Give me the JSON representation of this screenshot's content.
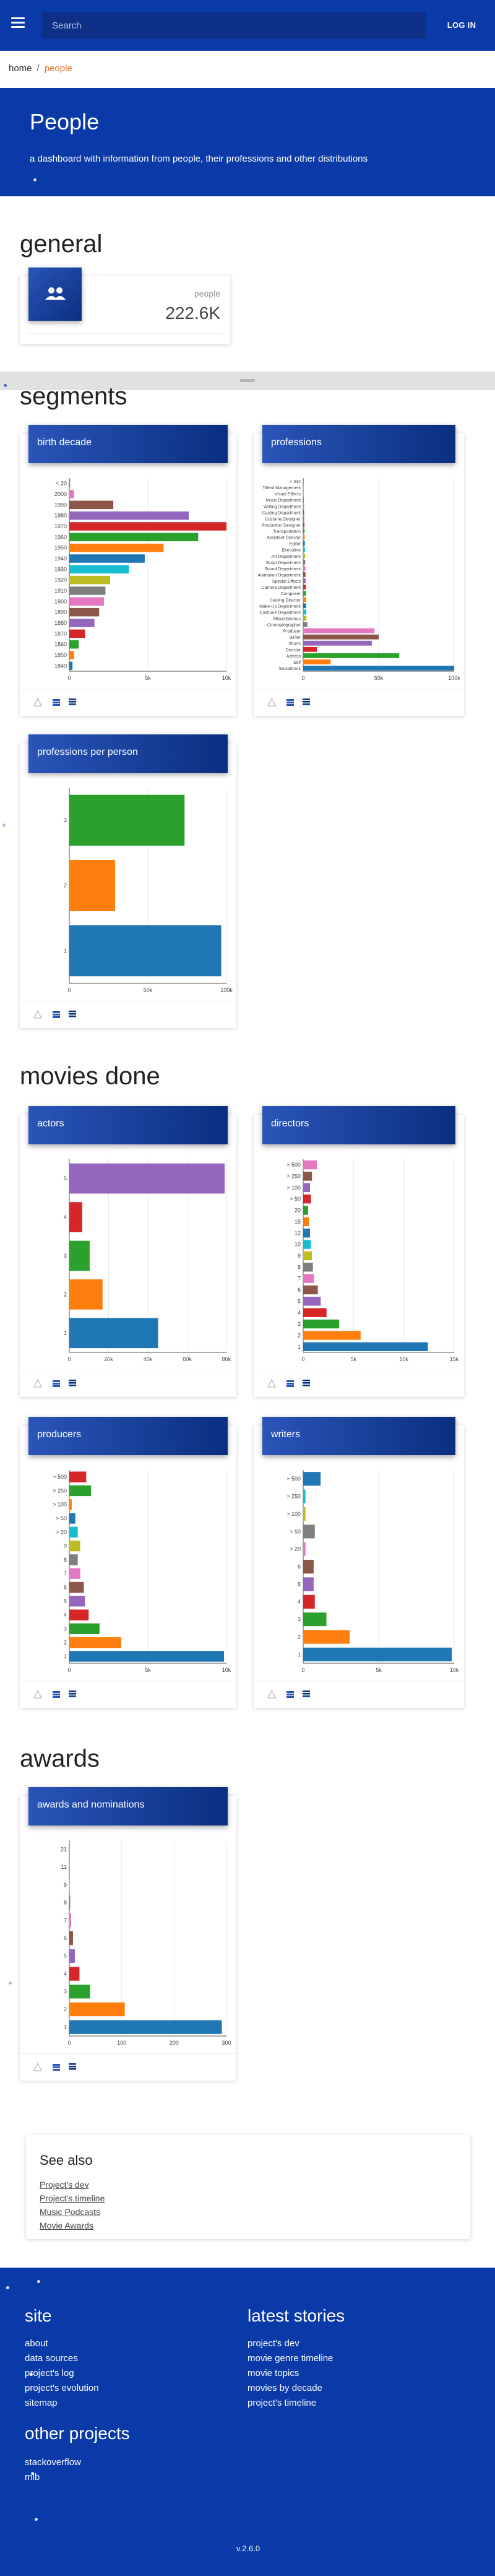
{
  "topbar": {
    "search_placeholder": "Search",
    "login_label": "LOG IN"
  },
  "breadcrumb": {
    "home": "home",
    "separator": "/",
    "current": "people"
  },
  "hero": {
    "title": "People",
    "subtitle": "a dashboard with information from people, their professions and other distributions"
  },
  "sections": {
    "general": "general",
    "segments": "segments",
    "movies_done": "movies done",
    "awards": "awards"
  },
  "kpi": {
    "label": "people",
    "value": "222.6K",
    "icon": "people-icon"
  },
  "cards": {
    "birth_decade": "birth decade",
    "professions": "professions",
    "professions_per_person": "professions per person",
    "actors": "actors",
    "directors": "directors",
    "producers": "producers",
    "writers": "writers",
    "awards_and_nominations": "awards and nominations"
  },
  "chart_data": [
    {
      "id": "birth_decade",
      "type": "bar",
      "orientation": "horizontal",
      "categories": [
        "< 20",
        "2000",
        "1990",
        "1980",
        "1970",
        "1960",
        "1950",
        "1940",
        "1930",
        "1920",
        "1910",
        "1900",
        "1890",
        "1880",
        "1870",
        "1860",
        "1850",
        "1840"
      ],
      "values": [
        50,
        300,
        2800,
        7600,
        10000,
        8200,
        6000,
        4800,
        3800,
        2600,
        2300,
        2200,
        1900,
        1600,
        1000,
        600,
        300,
        200
      ],
      "xticks": [
        "0",
        "5k",
        "10k"
      ],
      "xlim": [
        0,
        10000
      ]
    },
    {
      "id": "professions",
      "type": "bar",
      "orientation": "horizontal",
      "categories": [
        "< 332",
        "Talent Management",
        "Visual Effects",
        "Music Department",
        "Writing Department",
        "Casting Department",
        "Costume Designer",
        "Production Designer",
        "Transportation",
        "Assistant Director",
        "Editor",
        "Executive",
        "Art Department",
        "Script Department",
        "Sound Department",
        "Animation Department",
        "Special Effects",
        "Camera Department",
        "Composer",
        "Casting Director",
        "Make-Up Department",
        "Costume Department",
        "Miscellaneous",
        "Cinematographer",
        "Producer",
        "Writer",
        "Stunts",
        "Director",
        "Actress",
        "Self",
        "Soundtrack"
      ],
      "values": [
        300,
        300,
        400,
        500,
        600,
        700,
        800,
        900,
        1000,
        1100,
        1200,
        1300,
        1400,
        1500,
        1600,
        1700,
        1800,
        1900,
        2000,
        2100,
        2200,
        2300,
        2400,
        3000,
        52000,
        55000,
        50000,
        10000,
        70000,
        20000,
        110000
      ],
      "xticks": [
        "0",
        "50k",
        "100k"
      ],
      "xlim": [
        0,
        110000
      ]
    },
    {
      "id": "professions_per_person",
      "type": "bar",
      "orientation": "horizontal",
      "categories": [
        "3",
        "2",
        "1"
      ],
      "values": [
        88000,
        35000,
        116000
      ],
      "colors": [
        "#2ca02c",
        "#ff7f0e",
        "#1f77b4"
      ],
      "xticks": [
        "0",
        "50k",
        "100k"
      ],
      "xlim": [
        0,
        120000
      ]
    },
    {
      "id": "actors",
      "type": "bar",
      "orientation": "horizontal",
      "categories": [
        "5",
        "4",
        "3",
        "2",
        "1"
      ],
      "values": [
        84000,
        7000,
        11000,
        18000,
        48000
      ],
      "colors": [
        "#9467bd",
        "#d62728",
        "#2ca02c",
        "#ff7f0e",
        "#1f77b4"
      ],
      "xticks": [
        "0",
        "20k",
        "40k",
        "60k",
        "80k"
      ],
      "xlim": [
        0,
        85000
      ]
    },
    {
      "id": "directors",
      "type": "bar",
      "orientation": "horizontal",
      "categories": [
        "> 500",
        "> 250",
        "> 100",
        "> 50",
        "20",
        "15",
        "12",
        "10",
        "9",
        "8",
        "7",
        "6",
        "5",
        "4",
        "3",
        "2",
        "1"
      ],
      "values": [
        1400,
        900,
        700,
        800,
        500,
        600,
        700,
        800,
        900,
        1000,
        1100,
        1500,
        1800,
        2400,
        3700,
        5900,
        12800
      ],
      "xticks": [
        "0",
        "5k",
        "10k",
        "15k"
      ],
      "xlim": [
        0,
        15500
      ]
    },
    {
      "id": "producers",
      "type": "bar",
      "orientation": "horizontal",
      "categories": [
        "> 500",
        "> 250",
        "> 100",
        "> 50",
        "> 20",
        "9",
        "8",
        "7",
        "6",
        "5",
        "4",
        "3",
        "2",
        "1"
      ],
      "values": [
        1400,
        1800,
        200,
        500,
        700,
        900,
        700,
        900,
        1200,
        1300,
        1600,
        2500,
        4300,
        12800
      ],
      "xticks": [
        "0",
        "5k",
        "10k"
      ],
      "xlim": [
        0,
        13000
      ]
    },
    {
      "id": "writers",
      "type": "bar",
      "orientation": "horizontal",
      "categories": [
        "> 500",
        "> 250",
        "> 100",
        "> 50",
        "> 20",
        "6",
        "5",
        "4",
        "3",
        "2",
        "1"
      ],
      "values": [
        1500,
        200,
        200,
        1000,
        200,
        900,
        900,
        1000,
        2000,
        4000,
        12800
      ],
      "xticks": [
        "0",
        "5k",
        "10k"
      ],
      "xlim": [
        0,
        13000
      ]
    },
    {
      "id": "awards_and_nominations",
      "type": "bar",
      "orientation": "horizontal",
      "categories": [
        "21",
        "11",
        "9",
        "8",
        "7",
        "6",
        "5",
        "4",
        "3",
        "2",
        "1"
      ],
      "values": [
        0,
        1,
        1,
        2,
        4,
        8,
        12,
        22,
        45,
        120,
        330
      ],
      "xticks": [
        "0",
        "100",
        "200",
        "300"
      ],
      "xlim": [
        0,
        340
      ]
    }
  ],
  "see_also": {
    "title": "See also",
    "links": [
      "Project's dev",
      "Project's timeline",
      "Music Podcasts",
      "Movie Awards"
    ]
  },
  "footer": {
    "site_title": "site",
    "site_links": [
      "about",
      "data sources",
      "project's log",
      "project's evolution",
      "sitemap"
    ],
    "stories_title": "latest stories",
    "story_links": [
      "project's dev",
      "movie genre timeline",
      "movie topics",
      "movies by decade",
      "project's timeline"
    ],
    "other_title": "other projects",
    "other_links": [
      "stackoverflow",
      "mlb"
    ],
    "version": "v.2.6.0"
  },
  "palette": [
    "#1f77b4",
    "#ff7f0e",
    "#2ca02c",
    "#d62728",
    "#9467bd",
    "#8c564b",
    "#e377c2",
    "#7f7f7f",
    "#bcbd22",
    "#17becf"
  ]
}
